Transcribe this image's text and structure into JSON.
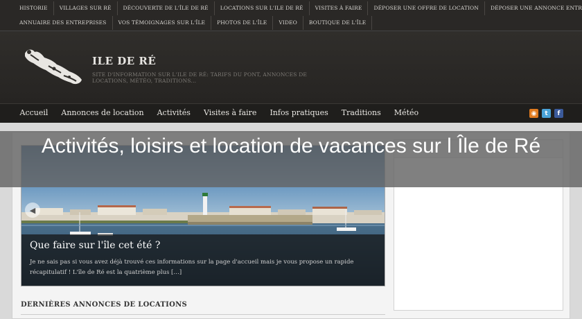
{
  "toplinks_row1": [
    "Historie",
    "Villages sur Ré",
    "Découverte de l'Île de Ré",
    "Locations sur l'ile de Ré",
    "Visites à faire",
    "Déposer une offre de location",
    "Déposer une annonce entreprise"
  ],
  "toplinks_row2": [
    "Annuaire des entreprises",
    "Vos témoignages sur l'île",
    "Photos de l'île",
    "Video",
    "Boutique de l'île"
  ],
  "site": {
    "title": "ILE DE RÉ",
    "description": "Site d'information sur l'Ile de Ré: Tarifs du pont, annonces de locations, météo, traditions..."
  },
  "nav": [
    "Accueil",
    "Annonces de location",
    "Activités",
    "Visites à faire",
    "Infos pratiques",
    "Traditions",
    "Météo"
  ],
  "social": {
    "rss_glyph": "◉",
    "twitter_glyph": "t",
    "facebook_glyph": "f"
  },
  "slider": {
    "prev_glyph": "◀",
    "title": "Que faire sur l'île cet été ?",
    "text": "Je ne sais pas si vous avez déjà trouvé ces informations sur la page d'accueil mais je vous propose un rapide récapitulatif ! L'île de Ré est la quatrième plus […]"
  },
  "section_title": "Dernières annonces de locations",
  "sidebar": {
    "header": ""
  },
  "overlay": {
    "text": "Activités, loisirs et location de vacances sur l Île de Ré"
  },
  "colors": {
    "topbar": "#2a2826",
    "header": "#302e2b",
    "nav": "#1f1e1c",
    "content_bg": "#f4f4f4",
    "overlay": "#646464"
  }
}
